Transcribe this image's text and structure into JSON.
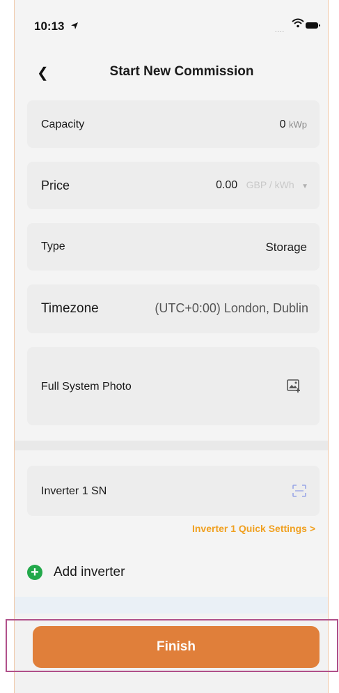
{
  "status_bar": {
    "time": "10:13"
  },
  "nav": {
    "title": "Start New Commission"
  },
  "fields": {
    "capacity": {
      "label": "Capacity",
      "value": "0",
      "unit": "kWp"
    },
    "price": {
      "label": "Price",
      "value": "0.00",
      "unit": "GBP / kWh"
    },
    "type": {
      "label": "Type",
      "value": "Storage"
    },
    "timezone": {
      "label": "Timezone",
      "value": "(UTC+0:00) London, Dublin"
    },
    "photo": {
      "label": "Full System Photo"
    },
    "inverter_sn": {
      "label": "Inverter 1 SN"
    }
  },
  "links": {
    "quick_settings": "Inverter 1 Quick Settings >"
  },
  "actions": {
    "add_inverter": "Add inverter",
    "finish": "Finish"
  },
  "colors": {
    "accent": "#e07f3a",
    "link": "#f0a020",
    "add_green": "#22a84a"
  }
}
